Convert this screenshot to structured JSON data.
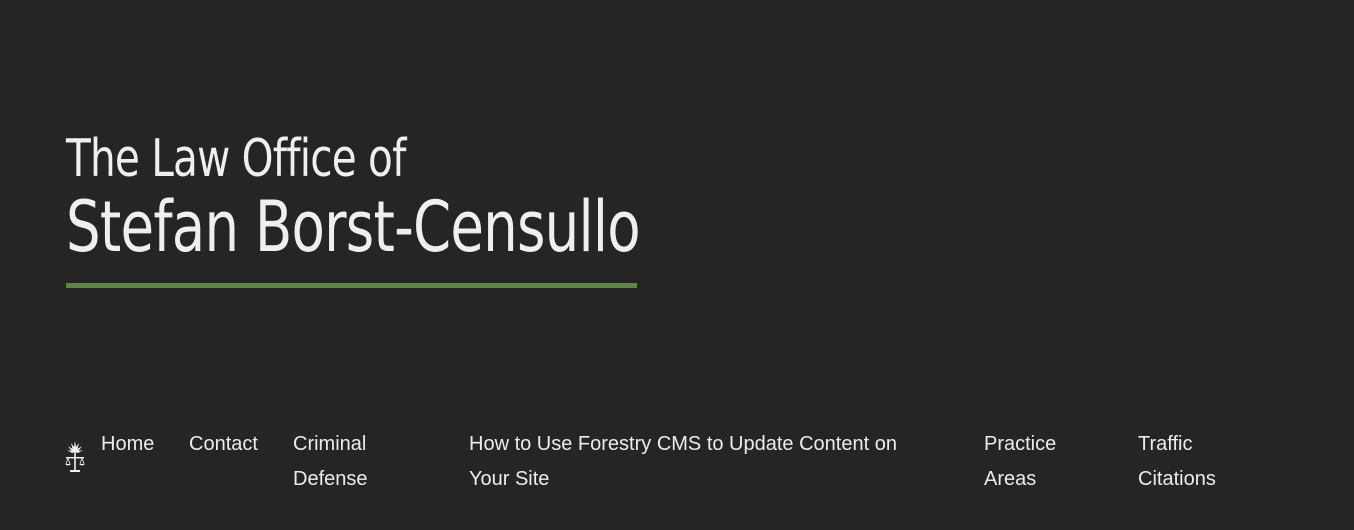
{
  "hero": {
    "line1": "The Law Office of",
    "line2": "Stefan Borst-Censullo",
    "underline_color": "#5c8a3c"
  },
  "nav": {
    "logo_icon": "scales-of-justice-tree-icon",
    "items": [
      {
        "label": "Home"
      },
      {
        "label": "Contact"
      },
      {
        "label": "Criminal Defense"
      },
      {
        "label": "How to Use Forestry CMS to Update Content on Your Site"
      },
      {
        "label": "Practice Areas"
      },
      {
        "label": "Traffic Citations"
      }
    ]
  },
  "colors": {
    "background": "#252525",
    "text": "#ececec",
    "accent": "#5c8a3c"
  }
}
